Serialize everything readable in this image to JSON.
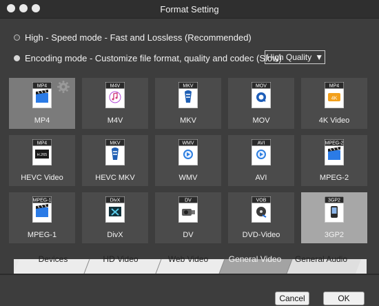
{
  "window": {
    "title": "Format Setting"
  },
  "modes": {
    "high_speed": {
      "label": "High - Speed mode - Fast and Lossless (Recommended)",
      "selected": false
    },
    "encoding": {
      "label": "Encoding mode - Customize file format, quality and codec (Slow)",
      "selected": true
    }
  },
  "quality": {
    "value": "High Quality",
    "arrow": "▼"
  },
  "formats": [
    {
      "badge": "MP4",
      "label": "MP4",
      "icon": "clapper-icon"
    },
    {
      "badge": "M4V",
      "label": "M4V",
      "icon": "music-note-icon"
    },
    {
      "badge": "MKV",
      "label": "MKV",
      "icon": "mkv-logo-icon"
    },
    {
      "badge": "MOV",
      "label": "MOV",
      "icon": "quicktime-icon"
    },
    {
      "badge": "MP4",
      "label": "4K Video",
      "icon": "4k-icon",
      "icon_text": "4K"
    },
    {
      "badge": "MP4",
      "label": "HEVC Video",
      "icon": "h265-icon",
      "icon_text": "H.265"
    },
    {
      "badge": "MKV",
      "label": "HEVC MKV",
      "icon": "mkv-logo-icon"
    },
    {
      "badge": "WMV",
      "label": "WMV",
      "icon": "wmv-play-icon"
    },
    {
      "badge": "AVI",
      "label": "AVI",
      "icon": "avi-play-icon"
    },
    {
      "badge": "MPEG-2",
      "label": "MPEG-2",
      "icon": "clapper-icon"
    },
    {
      "badge": "MPEG-1",
      "label": "MPEG-1",
      "icon": "clapper-icon"
    },
    {
      "badge": "DivX",
      "label": "DivX",
      "icon": "divx-icon"
    },
    {
      "badge": "DV",
      "label": "DV",
      "icon": "camera-icon"
    },
    {
      "badge": "VOB",
      "label": "DVD-Video",
      "icon": "dvd-icon"
    },
    {
      "badge": "3GP2",
      "label": "3GP2",
      "icon": "phone-icon"
    }
  ],
  "tabs": [
    {
      "label": "Devices"
    },
    {
      "label": "HD Video"
    },
    {
      "label": "Web Video"
    },
    {
      "label": "General Video"
    },
    {
      "label": "General Audio"
    }
  ],
  "buttons": {
    "cancel": "Cancel",
    "ok": "OK"
  },
  "colors": {
    "accent": "#3b89e8",
    "selected_tile": "#7b7b7b"
  }
}
